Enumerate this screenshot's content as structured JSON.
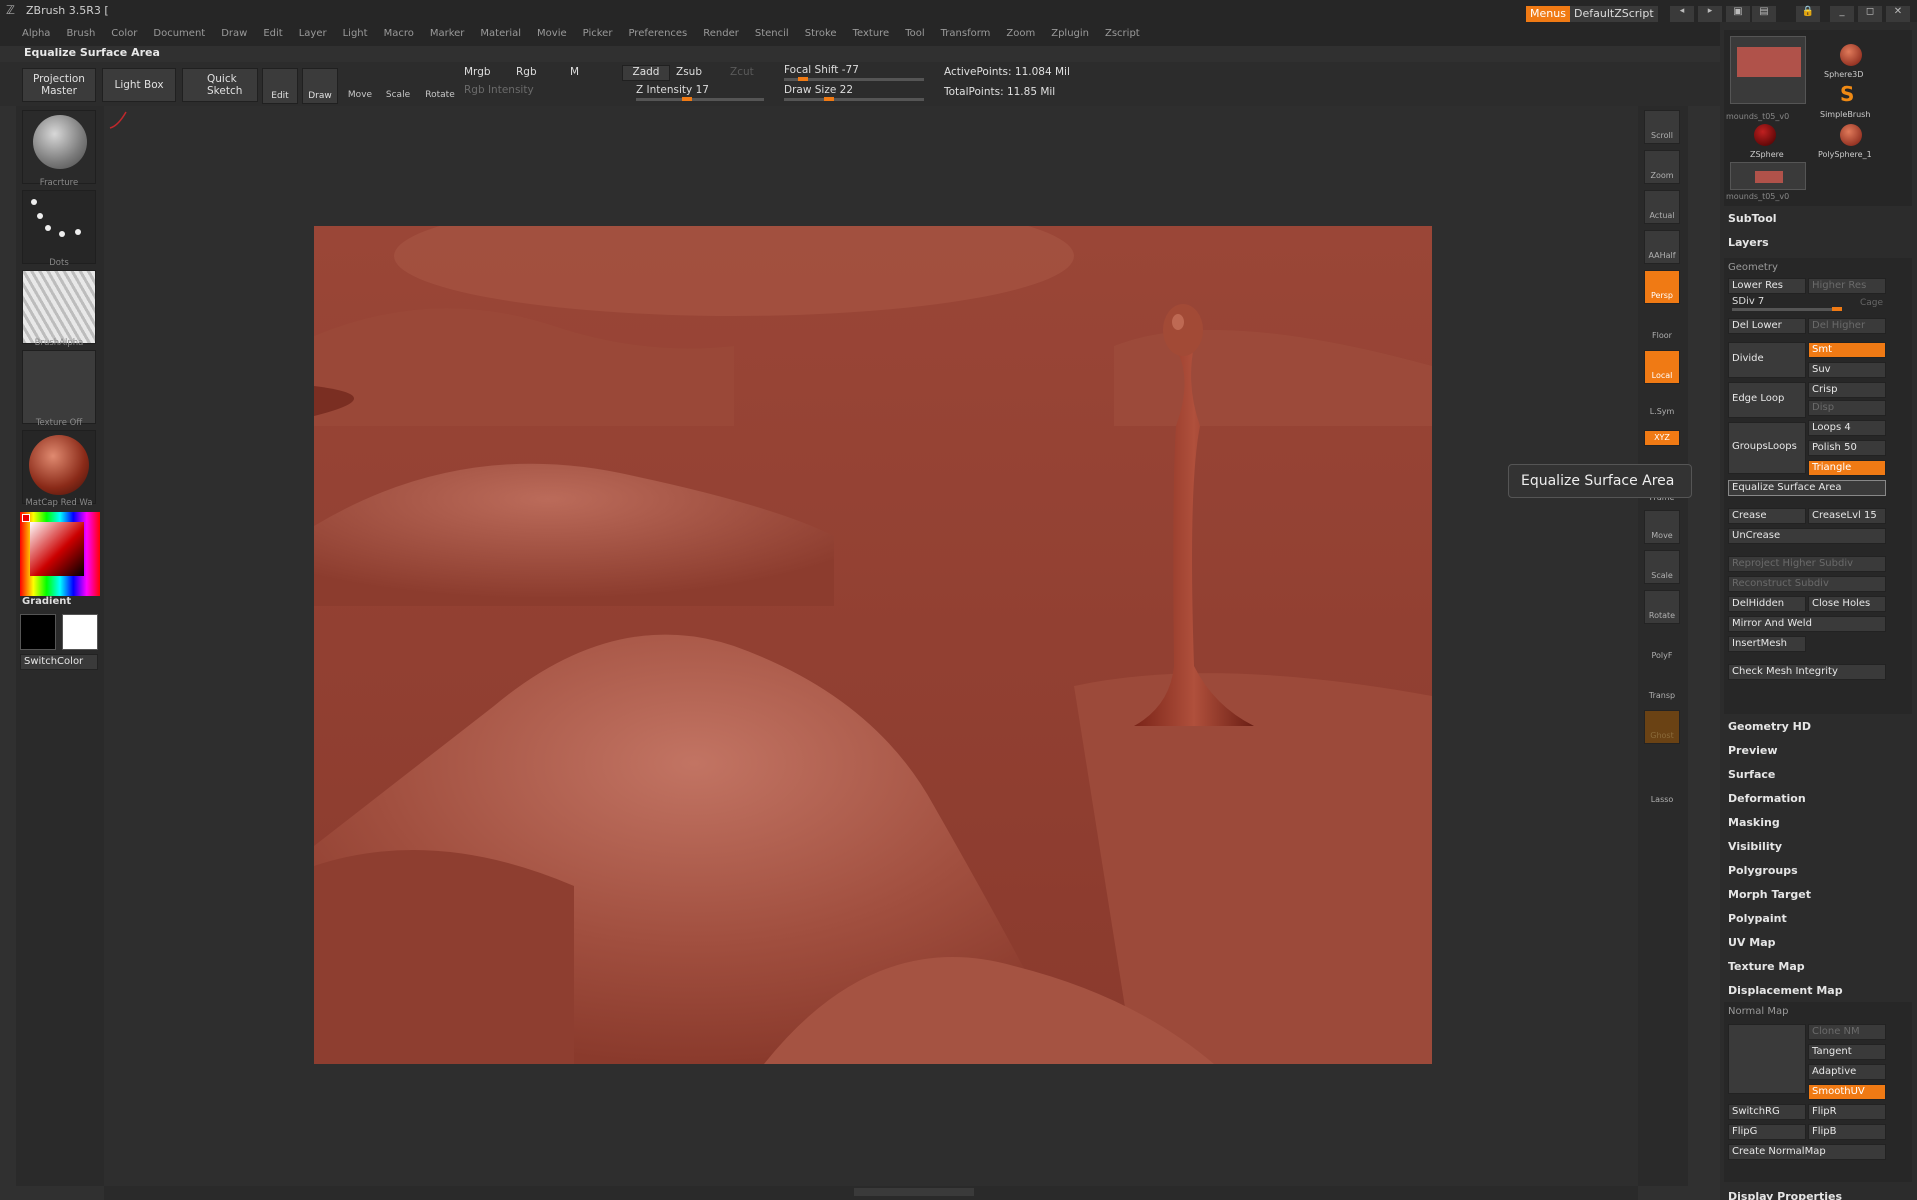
{
  "app": {
    "title": "ZBrush 3.5R3 [",
    "menus_button": "Menus",
    "script_button": "DefaultZScript"
  },
  "menubar": [
    "Alpha",
    "Brush",
    "Color",
    "Document",
    "Draw",
    "Edit",
    "Layer",
    "Light",
    "Macro",
    "Marker",
    "Material",
    "Movie",
    "Picker",
    "Preferences",
    "Render",
    "Stencil",
    "Stroke",
    "Texture",
    "Tool",
    "Transform",
    "Zoom",
    "Zplugin",
    "Zscript"
  ],
  "status": {
    "label": "Equalize Surface Area"
  },
  "toolbar": {
    "projection_master": "Projection\nMaster",
    "light_box": "Light Box",
    "quick_sketch": "Quick\nSketch",
    "edit": "Edit",
    "draw": "Draw",
    "move": "Move",
    "scale": "Scale",
    "rotate": "Rotate",
    "mrgb": "Mrgb",
    "rgb": "Rgb",
    "m": "M",
    "rgb_intensity": "Rgb Intensity",
    "zadd": "Zadd",
    "zsub": "Zsub",
    "zcut": "Zcut",
    "z_intensity": "Z Intensity 17",
    "focal_shift": "Focal Shift -77",
    "draw_size": "Draw Size 22",
    "active_points": "ActivePoints: 11.084 Mil",
    "total_points": "TotalPoints: 11.85 Mil"
  },
  "left_shelf": {
    "brush": "Fracrture",
    "stroke": "Dots",
    "alpha": "BrushAlpha",
    "texture": "Texture Off",
    "material": "MatCap Red Wa",
    "gradient": "Gradient",
    "switch_color": "SwitchColor"
  },
  "right_shelf": [
    "Scroll",
    "Zoom",
    "Actual",
    "AAHalf",
    "Persp",
    "Floor",
    "Local",
    "L.Sym",
    "XYZ",
    "Frame",
    "Move",
    "Scale",
    "Rotate",
    "PolyF",
    "Transp",
    "Ghost",
    "Lasso"
  ],
  "tool_tray": {
    "thumbs": [
      {
        "label": "mounds_t05_v0"
      },
      {
        "label": "Sphere3D"
      },
      {
        "label": "SimpleBrush"
      },
      {
        "label": "ZSphere"
      },
      {
        "label": "PolySphere_1"
      },
      {
        "label": "mounds_t05_v0"
      }
    ],
    "subtool": "SubTool",
    "layers": "Layers",
    "geometry": "Geometry",
    "lower_res": "Lower Res",
    "higher_res": "Higher Res",
    "sdiv": "SDiv 7",
    "cage": "Cage",
    "del_lower": "Del Lower",
    "del_higher": "Del Higher",
    "divide": "Divide",
    "smt": "Smt",
    "suv": "Suv",
    "edge_loop": "Edge Loop",
    "crisp": "Crisp",
    "disp": "Disp",
    "groups_loops": "GroupsLoops",
    "loops": "Loops 4",
    "polish": "Polish 50",
    "triangle": "Triangle",
    "equalize": "Equalize Surface Area",
    "crease": "Crease",
    "crease_lvl": "CreaseLvl 15",
    "uncrease": "UnCrease",
    "reproject": "Reproject Higher Subdiv",
    "reconstruct": "Reconstruct Subdiv",
    "del_hidden": "DelHidden",
    "close_holes": "Close Holes",
    "mirror_weld": "Mirror And Weld",
    "insert_mesh": "InsertMesh",
    "check_mesh": "Check Mesh Integrity",
    "sections": [
      "Geometry HD",
      "Preview",
      "Surface",
      "Deformation",
      "Masking",
      "Visibility",
      "Polygroups",
      "Morph Target",
      "Polypaint",
      "UV Map",
      "Texture Map",
      "Displacement Map"
    ],
    "normal_map": "Normal Map",
    "clone_nm": "Clone NM",
    "tangent": "Tangent",
    "adaptive": "Adaptive",
    "smooth_uv": "SmoothUV",
    "switch_rg": "SwitchRG",
    "flip_r": "FlipR",
    "flip_g": "FlipG",
    "flip_b": "FlipB",
    "create_normalmap": "Create NormalMap",
    "display_properties": "Display Properties"
  },
  "tooltip": "Equalize Surface Area",
  "colors": {
    "accent": "#f07a14",
    "clay": "#8a3a2c"
  }
}
